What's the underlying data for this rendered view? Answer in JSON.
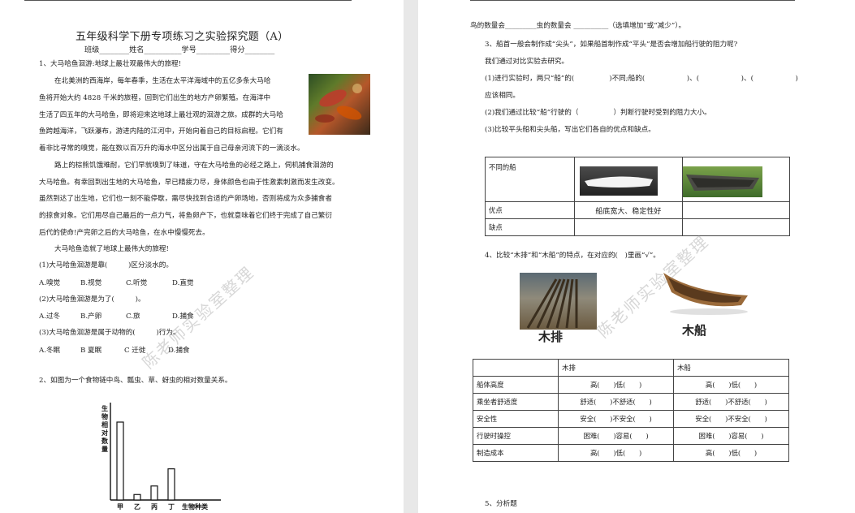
{
  "left": {
    "title": "五年级科学下册专项练习之实验探究题（A）",
    "info_line": "班级________姓名__________学号_________得分________",
    "q1": {
      "heading": "1、大马哈鱼洄游:地球上最壮观最伟大的旅程!",
      "p1": [
        "在北美洲的西海岸，每年春季，生活在太平洋海域中的五亿多条大马哈",
        "鱼将开始大约 4828 千米的旅程，回到它们出生的地方产卵繁殖。在海洋中",
        "生活了四五年的大马哈鱼，即将迎来这地球上最壮观的洄游之旅。成群的大马哈",
        "鱼跨越海洋，飞跃瀑布，游进内陆的江河中，开始向着自己的目标启程。它们有",
        "着非比寻常的嗅觉，能在数以百万升的海水中区分出属于自己母亲河流下的一滴淡水。"
      ],
      "p2": [
        "路上的棕熊饥饿难耐，它们早就嗅到了味道，守在大马哈鱼的必经之路上，伺机捕食洄游的",
        "大马哈鱼。有幸回到出生地的大马哈鱼，早已精疲力尽，身体颜色也由于性激素刺激而发生改变。",
        "虽然到达了出生地，它们也一刻不能停歇，需尽快找到合适的产卵场地，否则将成为众多捕食者",
        "的掠食对象。它们用尽自己最后的一点力气，将鱼卵产下，也就意味着它们终于完成了自己繁衍",
        "后代的使命!产完卵之后的大马哈鱼，在水中慢慢死去。"
      ],
      "p3": "大马哈鱼造就了地球上最伟大的旅程!",
      "sub1": "(1)大马哈鱼洄游是靠(　　　)区分淡水的。",
      "opts1": [
        "A.嗅觉",
        "B.视觉",
        "C.听觉",
        "D.直觉"
      ],
      "sub2": "(2)大马哈鱼洄游是为了(　　　)。",
      "opts2": [
        "A.过冬",
        "B.产卵",
        "C.旅",
        "D.捕食"
      ],
      "sub3": "(3)大马哈鱼洄游是属于动物的(　　　)行为。",
      "opts3": [
        "A.冬眠",
        "B 夏眠",
        "C 迁徙",
        "D.捕食"
      ]
    },
    "q2": {
      "heading": "2、如图为一个食物链中鸟、瓢虫、草、蚜虫的相对数量关系。"
    },
    "watermark": "陈老师实验室整理"
  },
  "chart_data": {
    "type": "bar",
    "categories": [
      "甲",
      "乙",
      "丙",
      "丁"
    ],
    "values": [
      100,
      7,
      18,
      40
    ],
    "ylabel": "生物相对数量",
    "xlabel": "生物种类",
    "ylim": [
      0,
      125
    ]
  },
  "right": {
    "line1": "鸟的数量会_________虫的数量会 __________（选填增加”或“减少”）。",
    "q3": {
      "heading": "3、船首一般会制作成“尖头”，如果船首制作成“平头”是否会增加船行驶的阻力呢?",
      "intro": "我们通过对比实验去研究。",
      "s1a": "(1)进行实验时，两只“船”的(　　　　　)不同;船的(　　　　　　)、(　　　　　　)、(　　　　　　)",
      "s1b": "应该相同。",
      "s2": "(2)我们通过比较“船”行驶的（　　　　　）判断行驶时受到的阻力大小。",
      "s3": "(3)比较平头船和尖头船，写出它们各自的优点和缺点。",
      "table": {
        "row1_label": "不同的船",
        "row2_label": "优点",
        "row2_val": "船底宽大、稳定性好",
        "row3_label": "缺点"
      }
    },
    "q4": {
      "heading": "4、比较“木排”和“木船”的特点，在对应的(　)里画“√”。",
      "img1_caption": "木排",
      "img2_caption": "木船",
      "headers": [
        "",
        "木排",
        "木船"
      ],
      "rows": [
        {
          "label": "船体高度",
          "a": "高(　　)低(　　)",
          "b": "高(　　)低(　　)"
        },
        {
          "label": "乘坐者舒适度",
          "a": "舒适(　　)不舒适(　　)",
          "b": "舒适(　　)不舒适(　　)"
        },
        {
          "label": "安全性",
          "a": "安全(　　)不安全(　　)",
          "b": "安全(　　)不安全(　　)"
        },
        {
          "label": "行驶时操控",
          "a": "困难(　　)容易(　　)",
          "b": "困难(　　)容易(　　)"
        },
        {
          "label": "制造成本",
          "a": "高(　　)低(　　)",
          "b": "高(　　)低(　　)"
        }
      ]
    },
    "q5_heading": "5、分析题",
    "watermark": "陈老师实验室整理"
  }
}
